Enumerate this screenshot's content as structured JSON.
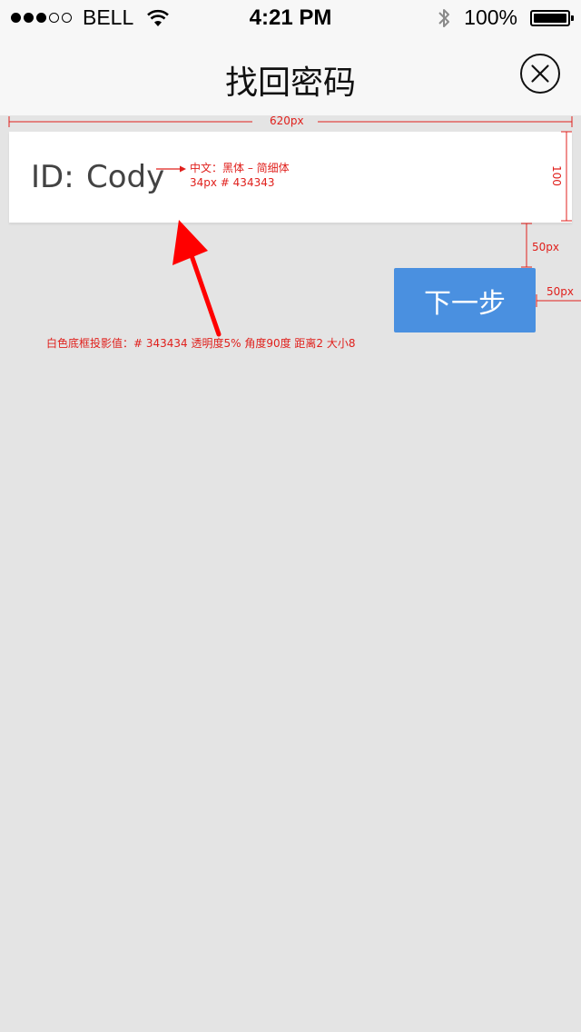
{
  "status_bar": {
    "carrier": "BELL",
    "time": "4:21 PM",
    "battery": "100%"
  },
  "nav": {
    "title": "找回密码",
    "close_icon": "close-circle-icon"
  },
  "form": {
    "id_label": "ID:",
    "id_value": "Cody"
  },
  "next_button": {
    "label": "下一步",
    "color": "#4a90e0"
  },
  "annotations": {
    "width_label": "620px",
    "height_label": "100",
    "font_spec_line1": "中文：黑体 – 简细体",
    "font_spec_line2": "34px    # 434343",
    "gap_label": "50px",
    "right_margin_label": "50px",
    "shadow_spec": "白色底框投影值：# 343434    透明度5%    角度90度    距离2   大小8",
    "annotation_color": "#e0201c"
  }
}
